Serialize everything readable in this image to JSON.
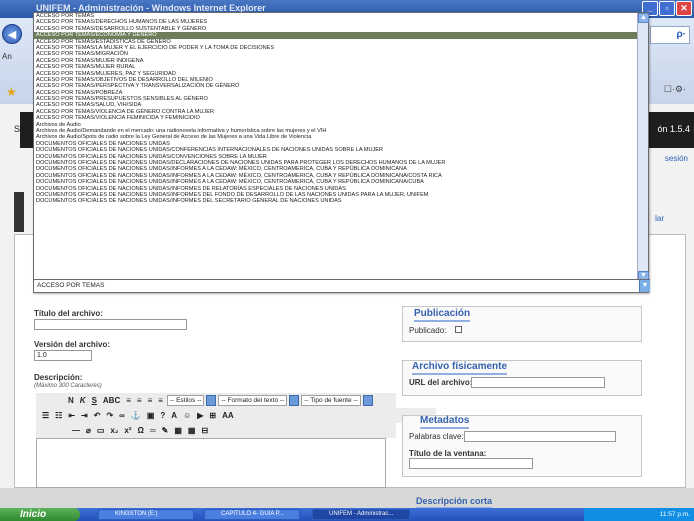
{
  "window": {
    "title": "UNIFEM - Administración - Windows Internet Explorer"
  },
  "browser": {
    "an_label": "An"
  },
  "page": {
    "version": "ón 1.5.4",
    "sesion_link": "sesión",
    "side_link": "lar",
    "s_left": "S"
  },
  "dropdown": {
    "selected_index": 3,
    "current_value": "ACCESO POR TEMAS",
    "options": [
      "ACCESO POR TEMAS",
      "ACCESO POR TEMAS/DERECHOS HUMANOS DE LAS MUJERES",
      "ACCESO POR TEMAS/DESARROLLO SUSTENTABLE Y GÉNERO",
      "ACCESO POR TEMAS/ECONOMIA Y GÉNERO",
      "ACCESO POR TEMAS/ESTADISTICAS DE GÉNERO",
      "ACCESO POR TEMAS/LA MUJER Y EL EJERCICIO DE PODER Y LA TOMA DE DECISIONES",
      "ACCESO POR TEMAS/MIGRACIÓN",
      "ACCESO POR TEMAS/MUJER INDIGENA",
      "ACCESO POR TEMAS/MUJER RURAL",
      "ACCESO POR TEMAS/MUJERES, PAZ Y SEGURIDAD",
      "ACCESO POR TEMAS/OBJETIVOS DE DESARROLLO DEL MILENIO",
      "ACCESO POR TEMAS/PERSPECTIVA Y TRANSVERSALIZACIÓN DE GÉNERO",
      "ACCESO POR TEMAS/POBREZA",
      "ACCESO POR TEMAS/PRESUPUESTOS SENSIBLES AL GÉNERO",
      "ACCESO POR TEMAS/SALUD, VIH/SIDA",
      "ACCESO POR TEMAS/VIOLENCIA DE GÉNERO CONTRA LA MUJER",
      "ACCESO POR TEMAS/VIOLENCIA FEMINICIDA Y FEMINICIDIO",
      "Archivos de Audio",
      "Archivos de Audio/Demandando en el mercado: una radionovela informativa y humorística sobre las mujeres y el VIH",
      "Archivos de Audio/Spots de radio sobre la Ley General de Acceso de las Mujeres a una Vida Libre de Violencia",
      "DOCUMENTOS OFICIALES DE NACIONES UNIDAS",
      "DOCUMENTOS OFICIALES DE NACIONES UNIDAS/CONFERENCIAS INTERNACIONALES DE NACIONES UNIDAS SOBRE LA MUJER",
      "DOCUMENTOS OFICIALES DE NACIONES UNIDAS/CONVENCIONES SOBRE LA MUJER",
      "DOCUMENTOS OFICIALES DE NACIONES UNIDAS/DECLARACIONES DE NACIONES UNIDAS PARA PROTEGER LOS DERECHOS HUMANOS DE LA MUJER",
      "DOCUMENTOS OFICIALES DE NACIONES UNIDAS/INFORMES A LA CEDAW: MÉXICO, CENTROAMERICA, CUBA Y REPÚBLICA DOMINICANA",
      "DOCUMENTOS OFICIALES DE NACIONES UNIDAS/INFORMES A LA CEDAW: MÉXICO, CENTROAMERICA, CUBA Y REPÚBLICA DOMINICANA/COSTA RICA",
      "DOCUMENTOS OFICIALES DE NACIONES UNIDAS/INFORMES A LA CEDAW: MÉXICO, CENTROAMERICA, CUBA Y REPÚBLICA DOMINICANA/CUBA",
      "DOCUMENTOS OFICIALES DE NACIONES UNIDAS/INFORMES DE RELATORÍAS ESPECIALES DE NACIONES UNIDAS",
      "DOCUMENTOS OFICIALES DE NACIONES UNIDAS/INFORMES DEL FONDO DE DESARROLLO DE LAS NACIONES UNIDAS PARA LA MUJER, UNIFEM",
      "DOCUMENTOS OFICIALES DE NACIONES UNIDAS/INFORMES DEL SECRETARIO GENERAL DE NACIONES UNIDAS"
    ]
  },
  "form": {
    "titulo_label": "Título del archivo:",
    "titulo_value": "",
    "version_label": "Versión del archivo:",
    "version_value": "1.0",
    "descripcion_label": "Descripción:",
    "descripcion_hint": "(Máximo 300 Caracteres)"
  },
  "editor_toolbar": {
    "estilos": "-- Estilos --",
    "formato": "-- Formato del texto --",
    "fuente": "-- Tipo de fuente --"
  },
  "publicacion": {
    "heading": "Publicación",
    "publicado_label": "Publicado:"
  },
  "archivo": {
    "heading": "Archivo físicamente",
    "url_label": "URL del archivo:"
  },
  "metadatos": {
    "heading": "Metadatos",
    "palabras_label": "Palabras clave:",
    "titulo_ventana_label": "Título de la ventana:"
  },
  "descripcion_corta": {
    "heading": "Descripción corta"
  },
  "taskbar": {
    "start": "Inicio",
    "tasks": [
      "KINGSTON (E:)",
      "CAPÍTULO 4- GUIA P...",
      "UNIFEM - Administrac..."
    ],
    "clock": "11:57 p.m."
  }
}
